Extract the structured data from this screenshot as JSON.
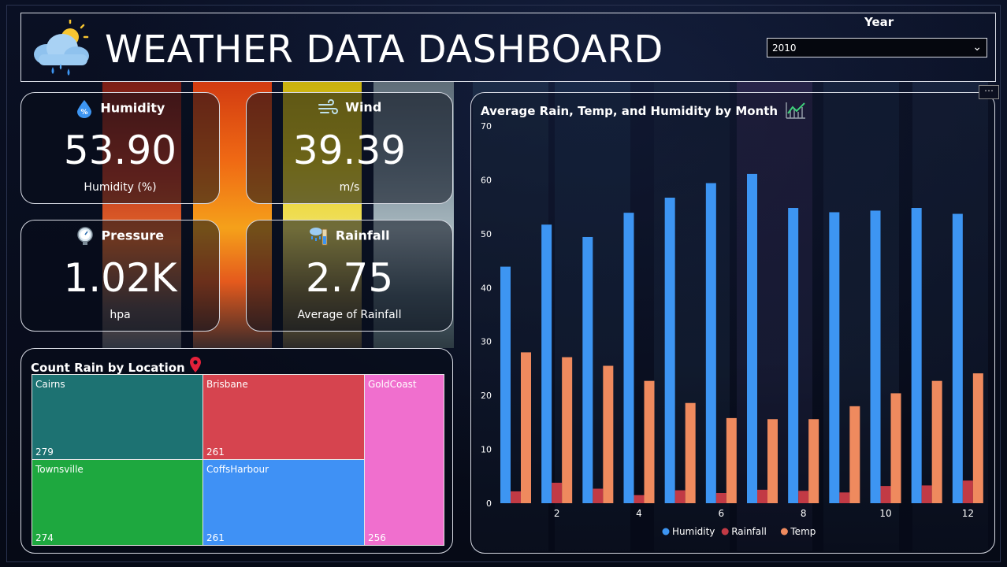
{
  "header": {
    "title": "WEATHER DATA DASHBOARD",
    "year_label": "Year",
    "year_value": "2010"
  },
  "kpis": {
    "humidity": {
      "label": "Humidity",
      "value": "53.90",
      "sub": "Humidity (%)",
      "icon": "humidity-drop-icon"
    },
    "wind": {
      "label": "Wind",
      "value": "39.39",
      "sub": "m/s",
      "icon": "wind-icon"
    },
    "pressure": {
      "label": "Pressure",
      "value": "1.02K",
      "sub": "hpa",
      "icon": "pressure-gauge-icon"
    },
    "rainfall": {
      "label": "Rainfall",
      "value": "2.75",
      "sub": "Average of Rainfall",
      "icon": "rain-gauge-icon"
    }
  },
  "treemap": {
    "title": "Count Rain by Location",
    "tiles": [
      {
        "name": "Cairns",
        "count": "279",
        "color": "#1d7272"
      },
      {
        "name": "Brisbane",
        "count": "261",
        "color": "#d6444f"
      },
      {
        "name": "GoldCoast",
        "count": "256",
        "color": "#f06fce"
      },
      {
        "name": "Townsville",
        "count": "274",
        "color": "#1ea83f"
      },
      {
        "name": "CoffsHarbour",
        "count": "261",
        "color": "#3f91f5"
      }
    ]
  },
  "chart_data": {
    "type": "bar",
    "title": "Average Rain, Temp, and Humidity by Month",
    "categories": [
      1,
      2,
      3,
      4,
      5,
      6,
      7,
      8,
      9,
      10,
      11,
      12
    ],
    "x_tick_labels": [
      "2",
      "4",
      "6",
      "8",
      "10",
      "12"
    ],
    "ylim": [
      0,
      70
    ],
    "y_ticks": [
      0,
      10,
      20,
      30,
      40,
      50,
      60,
      70
    ],
    "legend_position": "bottom",
    "series": [
      {
        "name": "Humidity",
        "color": "#3d95f2",
        "values": [
          43.9,
          51.7,
          49.4,
          53.9,
          56.7,
          59.4,
          61.1,
          54.8,
          54.0,
          54.3,
          54.8,
          53.7
        ]
      },
      {
        "name": "Rainfall",
        "color": "#c23a45",
        "values": [
          2.2,
          3.8,
          2.7,
          1.5,
          2.4,
          1.9,
          2.5,
          2.3,
          2.0,
          3.2,
          3.3,
          4.2
        ]
      },
      {
        "name": "Temp",
        "color": "#ef8a5e",
        "values": [
          28.0,
          27.1,
          25.5,
          22.7,
          18.6,
          15.8,
          15.6,
          15.6,
          18.0,
          20.4,
          22.7,
          24.1
        ]
      }
    ]
  }
}
